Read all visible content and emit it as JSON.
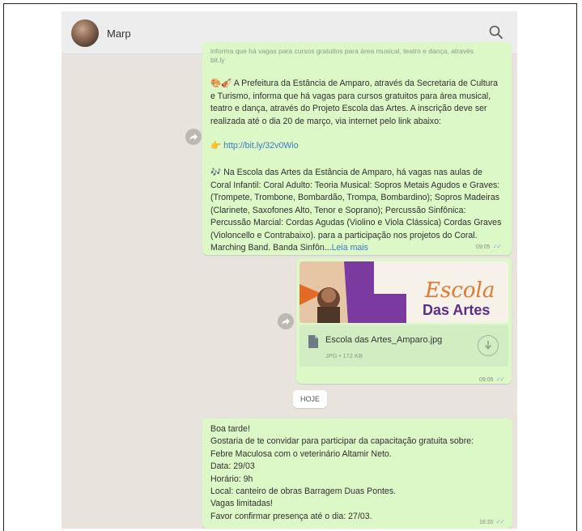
{
  "header": {
    "contact_name": "Marp",
    "search_icon": "search-icon"
  },
  "messages": {
    "m1": {
      "faded_line1": "informa que há vagas para cursos gratuitos para área musical, teatro e dança, através",
      "faded_line2": "bit.ly",
      "emoji": "🎨🎻",
      "text1": "A Prefeitura da Estância de Amparo, através da Secretaria de Cultura e Turismo, informa que há vagas para cursos gratuitos para área musical, teatro e dança, através do Projeto Escola das Artes. A inscrição deve ser realizada até o dia 20 de março, via internet pelo link abaixo:",
      "link_emoji": "👉",
      "link": "http://bit.ly/32v0Wio",
      "note_emoji": "🎶",
      "text2": "Na Escola das Artes da Estância de Amparo, há vagas nas aulas de Coral Infantil: Coral Adulto: Teoria Musical: Sopros Metais Agudos e Graves: (Trompete, Trombone, Bombardão, Trompa, Bombardino); Sopros Madeiras (Clarinete, Saxofones Alto, Tenor e Soprano); Percussão Sinfônica: Percussão Marcial: Cordas Agudas (Violino e Viola Clássica) Cordas Graves (Violoncello e Contrabaixo). para a participação nos projetos do Coral. Marching Band. Banda Sinfôn...",
      "read_more": "Leia mais",
      "time": "09:05"
    },
    "m2": {
      "image_title_1": "Escola",
      "image_title_2": "Das Artes",
      "file_name": "Escola das Artes_Amparo.jpg",
      "file_meta": "JPG • 172 KB",
      "time": "09:05"
    },
    "date_chip": "HOJE",
    "m3": {
      "lines": [
        "Boa tarde!",
        "Gostaria de te convidar para participar da capacitação gratuita sobre:",
        "Febre Maculosa com o veterinário Altamir Neto.",
        "Data: 29/03",
        "Horário: 9h",
        "Local: canteiro de obras Barragem Duas Pontes.",
        "Vagas limitadas!",
        "Favor confirmar presença até o dia: 27/03."
      ],
      "time": "16:20"
    }
  },
  "colors": {
    "chat_bg": "#e8e3dc",
    "bubble_out": "#dcf8c6",
    "link": "#3a78c8",
    "ticks": "#8bb1d6"
  }
}
